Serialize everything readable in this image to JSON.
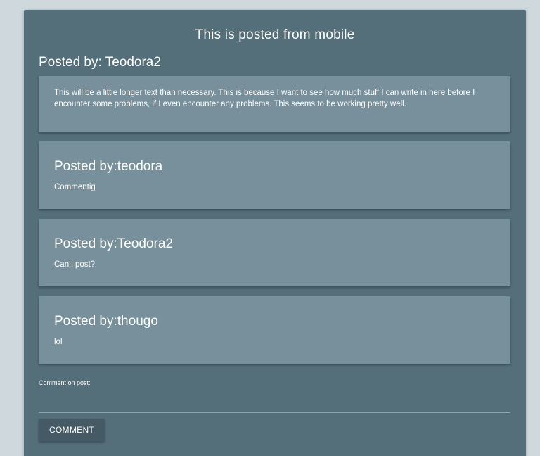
{
  "post": {
    "title": "This is posted from mobile",
    "posted_by": "Posted by: Teodora2",
    "body": "This will be a little longer text than necessary. This is because I want to see how much stuff I can write in here before I encounter some problems, if I even encounter any problems. This seems to be working pretty well."
  },
  "comments": [
    {
      "author": "Posted by:teodora",
      "text": "Commentig"
    },
    {
      "author": "Posted by:Teodora2",
      "text": "Can i post?"
    },
    {
      "author": "Posted by:thougo",
      "text": "lol"
    }
  ],
  "comment_form": {
    "label": "Comment on post:",
    "value": "",
    "button_label": "COMMENT"
  },
  "colors": {
    "page_background": "#cfd8dc",
    "card_background": "#546e7a",
    "box_background": "#78909c",
    "button_background": "#455a64"
  }
}
